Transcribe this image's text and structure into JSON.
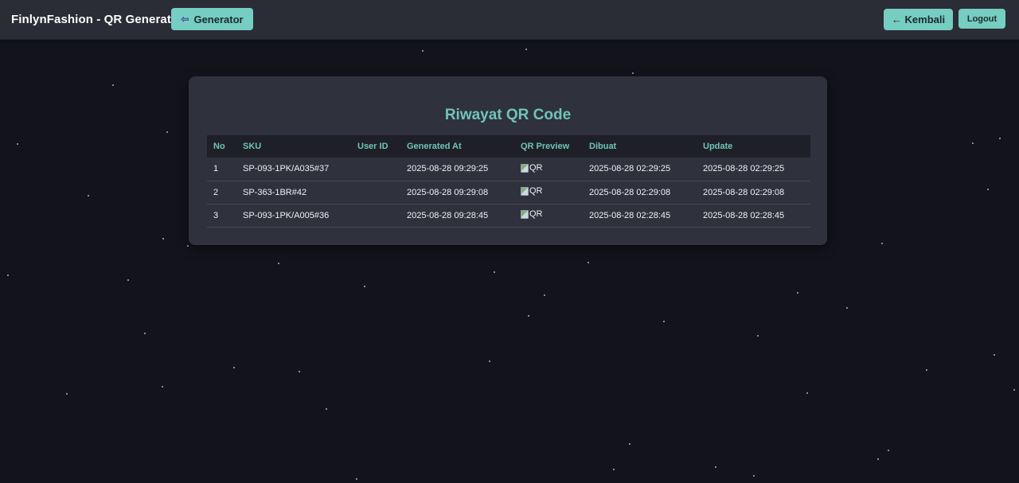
{
  "navbar": {
    "brand": "FinlynFashion - QR Generator",
    "generator_label": "Generator",
    "generator_icon": "back-arrow-icon",
    "kembali_label": "← Kembali",
    "logout_label": "Logout"
  },
  "card": {
    "title": "Riwayat QR Code"
  },
  "table": {
    "headers": {
      "no": "No",
      "sku": "SKU",
      "user_id": "User ID",
      "generated_at": "Generated At",
      "qr_preview": "QR Preview",
      "dibuat": "Dibuat",
      "update": "Update"
    },
    "rows": [
      {
        "no": "1",
        "sku": "SP-093-1PK/A035#37",
        "user_id": "",
        "generated_at": "2025-08-28 09:29:25",
        "qr_alt": "QR",
        "dibuat": "2025-08-28 02:29:25",
        "update": "2025-08-28 02:29:25"
      },
      {
        "no": "2",
        "sku": "SP-363-1BR#42",
        "user_id": "",
        "generated_at": "2025-08-28 09:29:08",
        "qr_alt": "QR",
        "dibuat": "2025-08-28 02:29:08",
        "update": "2025-08-28 02:29:08"
      },
      {
        "no": "3",
        "sku": "SP-093-1PK/A005#36",
        "user_id": "",
        "generated_at": "2025-08-28 09:28:45",
        "qr_alt": "QR",
        "dibuat": "2025-08-28 02:28:45",
        "update": "2025-08-28 02:28:45"
      }
    ]
  },
  "colors": {
    "background": "#13131c",
    "navbar": "#2a2c36",
    "card": "#2f313d",
    "accent": "#76cdc2",
    "title": "#6ec4b8"
  }
}
